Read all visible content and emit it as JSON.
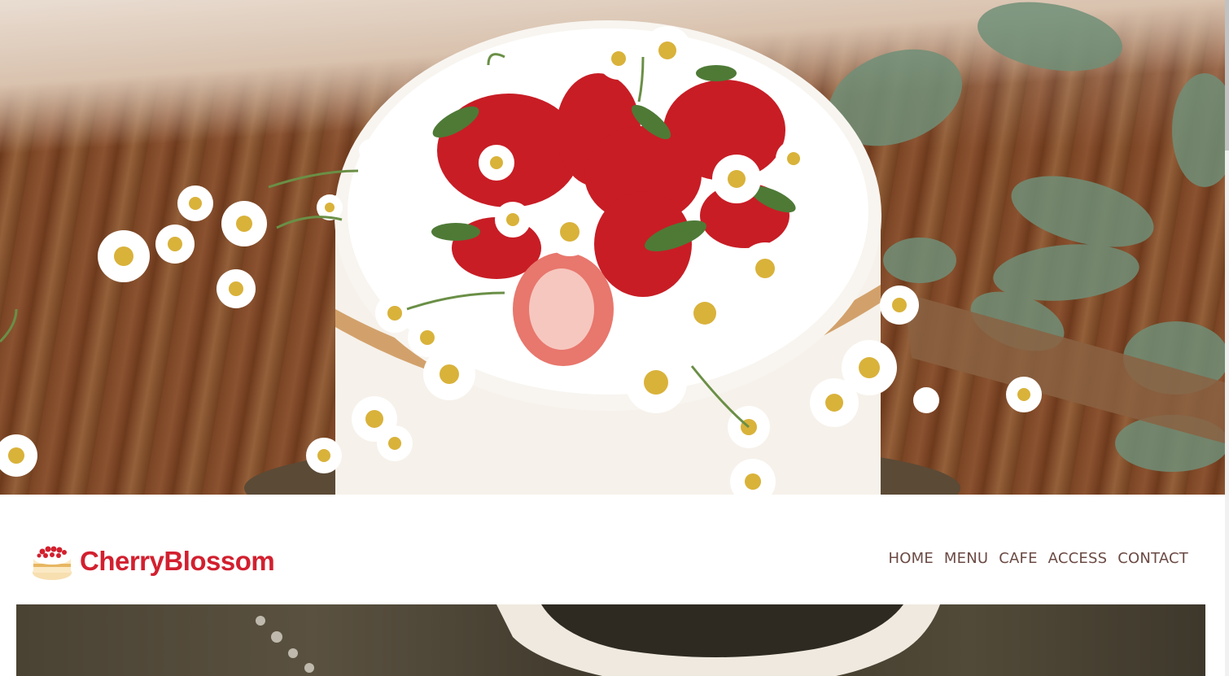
{
  "hero": {
    "image_description_icon": "cake-photo"
  },
  "brand": {
    "name": "CherryBlossom",
    "logo_icon": "cake-icon",
    "color": "#d2202f"
  },
  "nav": {
    "items": [
      {
        "label": "HOME"
      },
      {
        "label": "MENU"
      },
      {
        "label": "CAFE"
      },
      {
        "label": "ACCESS"
      },
      {
        "label": "CONTACT"
      }
    ],
    "color": "#6b4a44"
  }
}
